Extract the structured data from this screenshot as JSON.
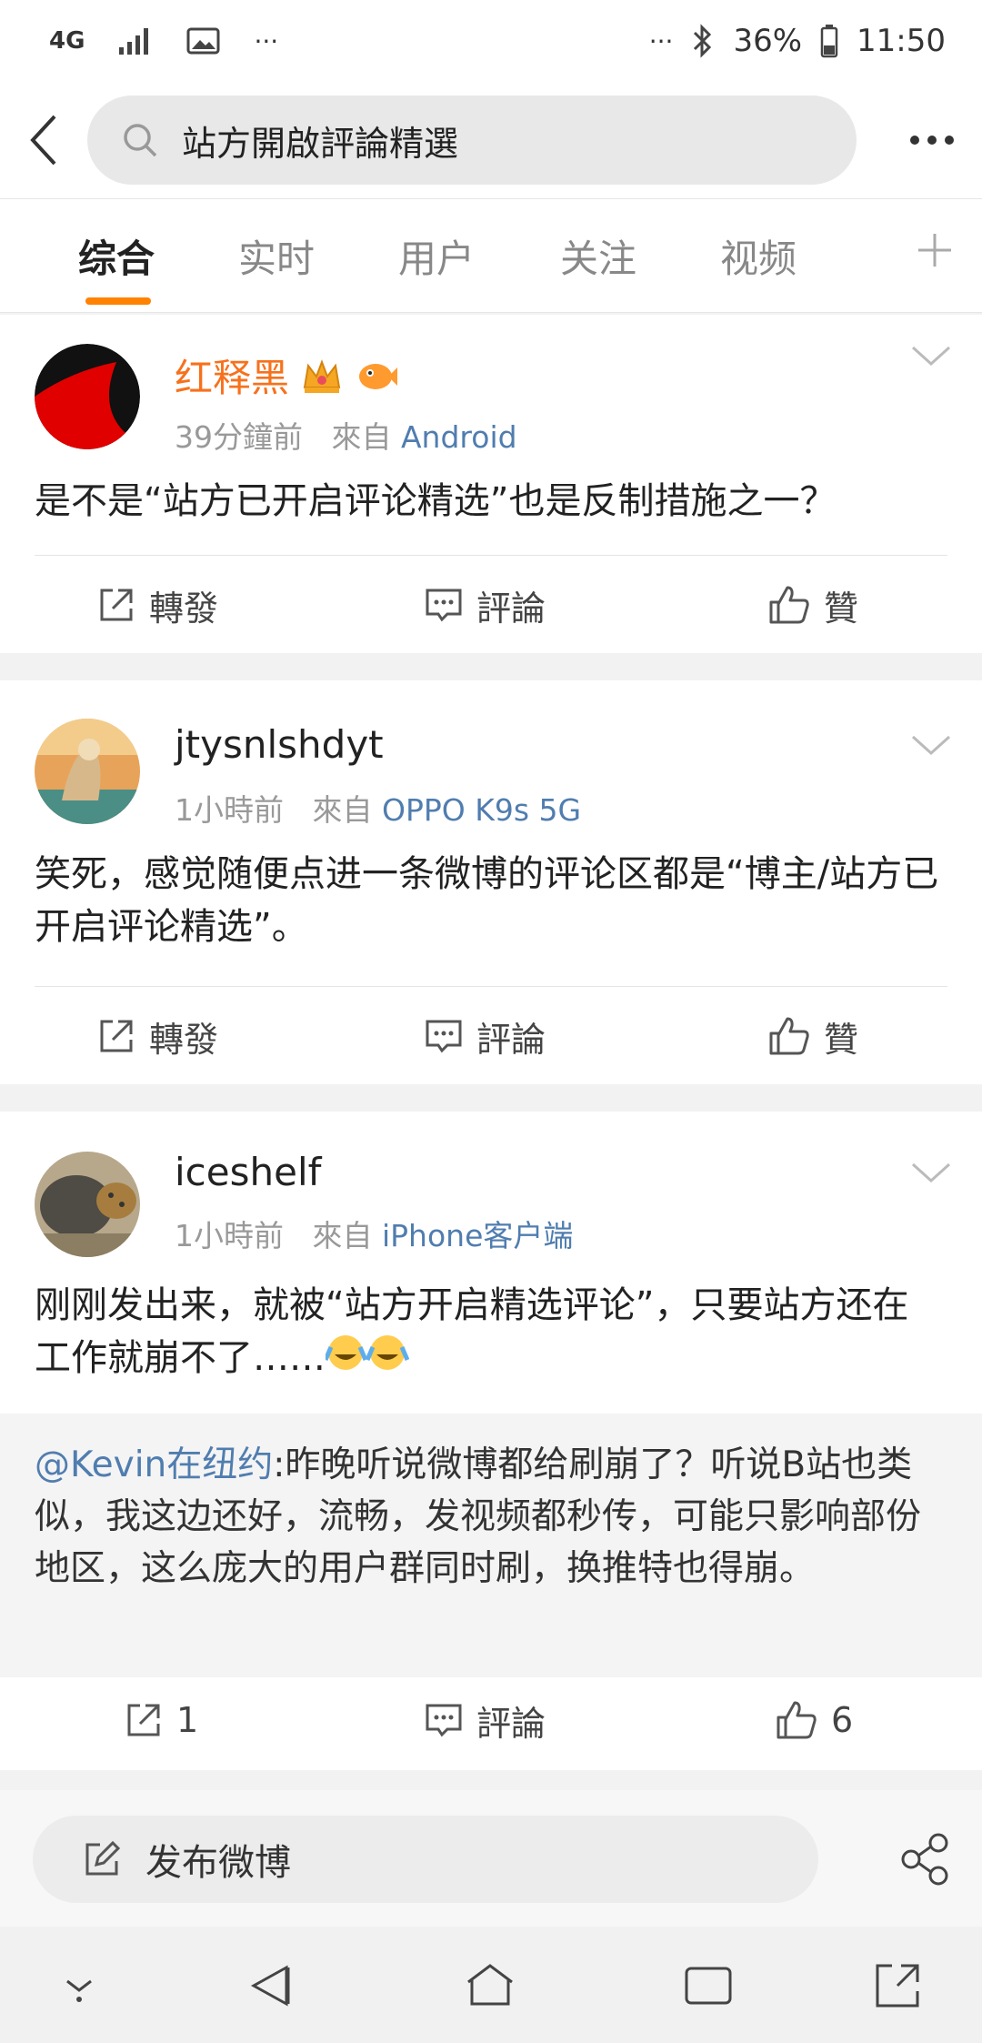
{
  "status_bar": {
    "network": "4G",
    "more": "···",
    "right_more": "···",
    "battery": "36%",
    "time": "11:50"
  },
  "search": {
    "query": "站方開啟評論精選"
  },
  "tabs": [
    {
      "label": "综合"
    },
    {
      "label": "实时"
    },
    {
      "label": "用户"
    },
    {
      "label": "关注"
    },
    {
      "label": "视频"
    }
  ],
  "posts": [
    {
      "username": "红释黑",
      "time": "39分鐘前",
      "from_label": "來自",
      "source": "Android",
      "text": "是不是“站方已开启评论精选”也是反制措施之一？",
      "repost_label": "轉發",
      "comment_label": "評論",
      "like_label": "贊"
    },
    {
      "username": "jtysnlshdyt",
      "time": "1小時前",
      "from_label": "來自",
      "source": "OPPO K9s 5G",
      "text": "笑死，感觉随便点进一条微博的评论区都是“博主/站方已开启评论精选”。",
      "repost_label": "轉發",
      "comment_label": "評論",
      "like_label": "贊"
    },
    {
      "username": "iceshelf",
      "time": "1小時前",
      "from_label": "來自",
      "source": "iPhone客户端",
      "text": "刚刚发出来，就被“站方开启精选评论”，只要站方还在工作就崩不了……",
      "quote_mention": "@Kevin在纽约",
      "quote_text": ":昨晚听说微博都给刷崩了？听说B站也类似，我这边还好，流畅，发视频都秒传，可能只影响部份地区，这么庞大的用户群同时刷，换推特也得崩。",
      "repost_count": "1",
      "comment_label": "評論",
      "like_count": "6"
    }
  ],
  "compose": {
    "label": "发布微博"
  },
  "colors": {
    "accent_orange": "#ff8200",
    "username_orange": "#f7711c",
    "link_blue": "#507daf"
  }
}
